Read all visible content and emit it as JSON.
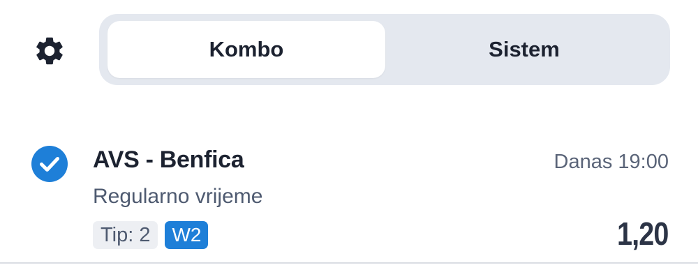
{
  "header": {
    "settings_icon": "gear-icon",
    "tabs": [
      {
        "label": "Kombo",
        "selected": true
      },
      {
        "label": "Sistem",
        "selected": false
      }
    ]
  },
  "bet": {
    "selected": true,
    "check_icon": "check-circle-icon",
    "match": "AVS - Benfica",
    "time": "Danas 19:00",
    "market": "Regularno vrijeme",
    "tip": "Tip: 2",
    "code": "W2",
    "odds": "1,20"
  },
  "colors": {
    "accent": "#1e7fd8",
    "text_primary": "#1c2230",
    "text_secondary": "#5a6478",
    "segment_bg": "#e4e8ef",
    "tag_bg": "#edeff3"
  }
}
